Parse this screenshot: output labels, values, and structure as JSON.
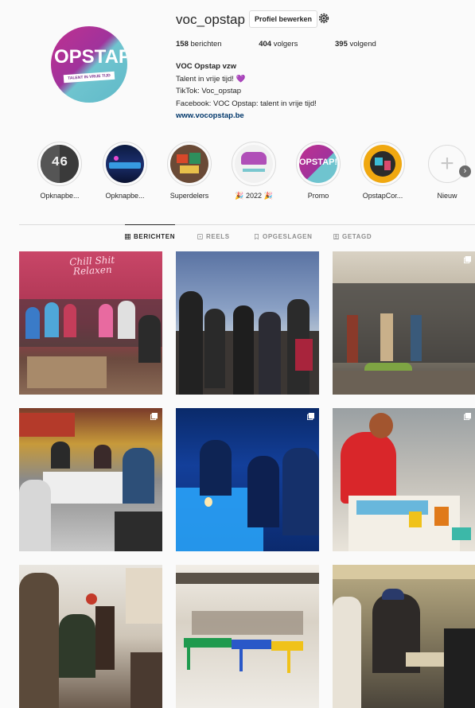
{
  "profile": {
    "username": "voc_opstap",
    "edit_label": "Profiel bewerken",
    "avatar_text": "OPSTAP!",
    "avatar_tagline": "TALENT IN VRIJE TIJD",
    "stats": {
      "posts_count": "158",
      "posts_label": "berichten",
      "followers_count": "404",
      "followers_label": "volgers",
      "following_count": "395",
      "following_label": "volgend"
    },
    "bio": {
      "name": "VOC Opstap vzw",
      "line1": "Talent in vrije tijd!",
      "heart": "💜",
      "line2": "TikTok: Voc_opstap",
      "line3": "Facebook: VOC Opstap: talent in vrije tijd!",
      "link": "www.vocopstap.be"
    }
  },
  "highlights": [
    {
      "label": "Opknapbe...",
      "number": "46"
    },
    {
      "label": "Opknapbe..."
    },
    {
      "label": "Superdelers"
    },
    {
      "label": "🎉 2022 🎉"
    },
    {
      "label": "Promo",
      "badge": "OPSTAP!"
    },
    {
      "label": "OpstapCor..."
    },
    {
      "label": "Nieuw",
      "symbol": "+"
    }
  ],
  "tabs": [
    {
      "label": "BERICHTEN",
      "icon": "grid-icon"
    },
    {
      "label": "REELS",
      "icon": "reels-icon"
    },
    {
      "label": "OPGESLAGEN",
      "icon": "bookmark-icon"
    },
    {
      "label": "GETAGD",
      "icon": "tagged-icon"
    }
  ],
  "posts": [
    {
      "sign_text": "Chill Shit Relaxen",
      "multi": false
    },
    {
      "multi": false
    },
    {
      "multi": true
    },
    {
      "multi": true
    },
    {
      "multi": true
    },
    {
      "multi": true
    },
    {
      "multi": false
    },
    {
      "multi": false
    },
    {
      "multi": false
    }
  ],
  "colors": {
    "text": "#262626",
    "muted": "#8e8e8e",
    "border": "#dbdbdb",
    "link": "#00376b",
    "brand_pink": "#c0308f",
    "brand_teal": "#6fc4cf"
  }
}
